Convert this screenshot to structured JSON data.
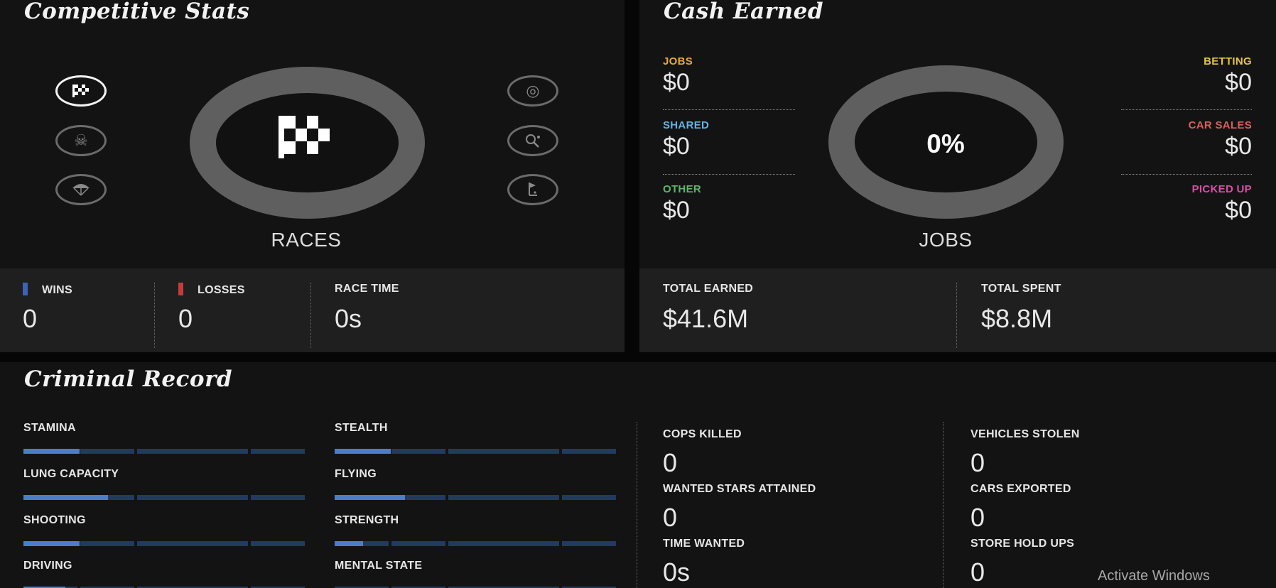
{
  "competitive": {
    "title": "Competitive Stats",
    "center_label": "RACES",
    "left_icons": [
      "checkered-flag-icon",
      "skull-crossbones-icon",
      "parachute-icon"
    ],
    "right_icons": [
      "target-icon",
      "tennis-icon",
      "golf-icon"
    ],
    "wins_label": "WINS",
    "wins_value": "0",
    "losses_label": "LOSSES",
    "losses_value": "0",
    "race_time_label": "RACE TIME",
    "race_time_value": "0s",
    "colors": {
      "wins": "#3d63b8",
      "losses": "#c43b3b"
    }
  },
  "cash": {
    "title": "Cash Earned",
    "center_percent": "0%",
    "center_label": "JOBS",
    "left": [
      {
        "label": "JOBS",
        "value": "$0",
        "color": "#e8a83e"
      },
      {
        "label": "SHARED",
        "value": "$0",
        "color": "#63b4e6"
      },
      {
        "label": "OTHER",
        "value": "$0",
        "color": "#5fb56a"
      }
    ],
    "right": [
      {
        "label": "BETTING",
        "value": "$0",
        "color": "#e8c24a"
      },
      {
        "label": "CAR SALES",
        "value": "$0",
        "color": "#d9605a"
      },
      {
        "label": "PICKED UP",
        "value": "$0",
        "color": "#d84fa8"
      }
    ],
    "total_earned_label": "TOTAL EARNED",
    "total_earned_value": "$41.6M",
    "total_spent_label": "TOTAL SPENT",
    "total_spent_value": "$8.8M"
  },
  "criminal": {
    "title": "Criminal Record",
    "skills": [
      {
        "label": "STAMINA",
        "fill": 0.2
      },
      {
        "label": "STEALTH",
        "fill": 0.2
      },
      {
        "label": "LUNG CAPACITY",
        "fill": 0.3
      },
      {
        "label": "FLYING",
        "fill": 0.25
      },
      {
        "label": "SHOOTING",
        "fill": 0.2
      },
      {
        "label": "STRENGTH",
        "fill": 0.1
      },
      {
        "label": "DRIVING",
        "fill": 0.15
      },
      {
        "label": "MENTAL STATE",
        "fill": 0.0
      }
    ],
    "stats": [
      {
        "label": "COPS KILLED",
        "value": "0"
      },
      {
        "label": "VEHICLES STOLEN",
        "value": "0"
      },
      {
        "label": "WANTED STARS ATTAINED",
        "value": "0"
      },
      {
        "label": "CARS EXPORTED",
        "value": "0"
      },
      {
        "label": "TIME WANTED",
        "value": "0s"
      },
      {
        "label": "STORE HOLD UPS",
        "value": "0"
      }
    ]
  },
  "watermark": "Activate Windows"
}
